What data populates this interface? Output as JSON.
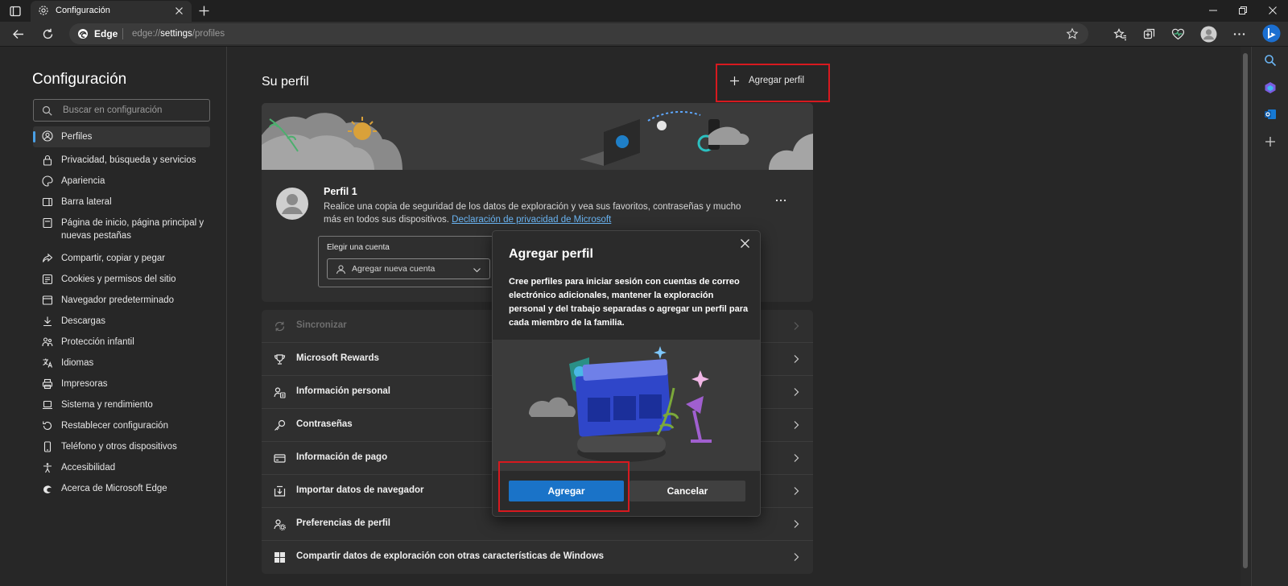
{
  "window": {
    "tab_title": "Configuración",
    "address": {
      "brand": "Edge",
      "url_prefix": "edge://",
      "url_strong": "settings",
      "url_suffix": "/profiles"
    }
  },
  "nav": {
    "title": "Configuración",
    "search_placeholder": "Buscar en configuración",
    "items": [
      {
        "label": "Perfiles",
        "icon": "profile-icon",
        "active": true
      },
      {
        "label": "Privacidad, búsqueda y servicios",
        "icon": "lock-icon"
      },
      {
        "label": "Apariencia",
        "icon": "palette-icon"
      },
      {
        "label": "Barra lateral",
        "icon": "sidebar-icon"
      },
      {
        "label": "Página de inicio, página principal y nuevas pestañas",
        "icon": "home-icon"
      },
      {
        "label": "Compartir, copiar y pegar",
        "icon": "share-icon"
      },
      {
        "label": "Cookies y permisos del sitio",
        "icon": "cookie-icon"
      },
      {
        "label": "Navegador predeterminado",
        "icon": "browser-icon"
      },
      {
        "label": "Descargas",
        "icon": "download-icon"
      },
      {
        "label": "Protección infantil",
        "icon": "family-icon"
      },
      {
        "label": "Idiomas",
        "icon": "language-icon"
      },
      {
        "label": "Impresoras",
        "icon": "printer-icon"
      },
      {
        "label": "Sistema y rendimiento",
        "icon": "laptop-icon"
      },
      {
        "label": "Restablecer configuración",
        "icon": "reset-icon"
      },
      {
        "label": "Teléfono y otros dispositivos",
        "icon": "phone-icon"
      },
      {
        "label": "Accesibilidad",
        "icon": "accessibility-icon"
      },
      {
        "label": "Acerca de Microsoft Edge",
        "icon": "edge-logo-icon"
      }
    ]
  },
  "main": {
    "title": "Su perfil",
    "add_profile_label": "Agregar perfil",
    "profile": {
      "name": "Perfil 1",
      "description": "Realice una copia de seguridad de los datos de exploración y vea sus favoritos, contraseñas y mucho más en todos sus dispositivos.",
      "link": "Declaración de privacidad de Microsoft",
      "account_label": "Elegir una cuenta",
      "account_select": "Agregar nueva cuenta"
    },
    "rows": [
      {
        "label": "Sincronizar",
        "icon": "sync-icon",
        "disabled": true
      },
      {
        "label": "Microsoft Rewards",
        "icon": "trophy-icon"
      },
      {
        "label": "Información personal",
        "icon": "person-card-icon"
      },
      {
        "label": "Contraseñas",
        "icon": "key-icon"
      },
      {
        "label": "Información de pago",
        "icon": "credit-card-icon"
      },
      {
        "label": "Importar datos de navegador",
        "icon": "import-icon"
      },
      {
        "label": "Preferencias de perfil",
        "icon": "profile-settings-icon"
      },
      {
        "label": "Compartir datos de exploración con otras características de Windows",
        "icon": "windows-icon"
      }
    ]
  },
  "dialog": {
    "title": "Agregar perfil",
    "text": "Cree perfiles para iniciar sesión con cuentas de correo electrónico adicionales, mantener la exploración personal y del trabajo separadas o agregar un perfil para cada miembro de la familia.",
    "primary": "Agregar",
    "secondary": "Cancelar"
  },
  "colors": {
    "accent": "#1a73c8",
    "highlight": "#d7191f",
    "link": "#6ab4f2"
  }
}
